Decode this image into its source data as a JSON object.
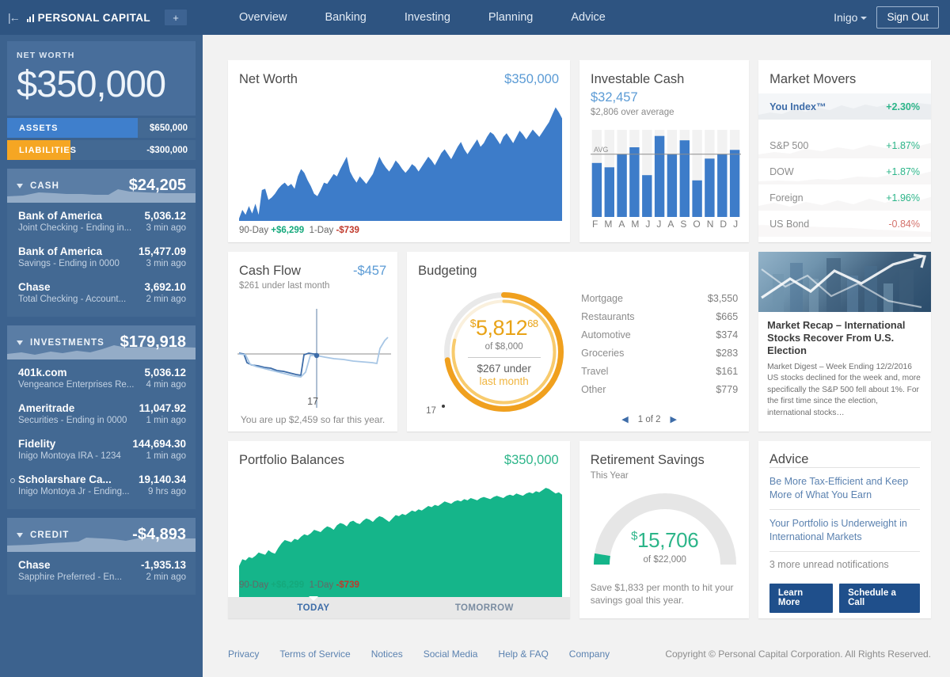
{
  "topnav": {
    "collapse_icon": "collapse-sidebar-icon",
    "brand": "PERSONAL CAPITAL",
    "add_label": "+",
    "menu": [
      {
        "label": "Overview"
      },
      {
        "label": "Banking"
      },
      {
        "label": "Investing"
      },
      {
        "label": "Planning"
      },
      {
        "label": "Advice"
      }
    ],
    "user": "Inigo",
    "sign_out": "Sign Out"
  },
  "sidebar": {
    "net_worth_label": "NET WORTH",
    "net_worth_value": "$350,000",
    "assets_label": "ASSETS",
    "assets_value": "$650,000",
    "liabilities_label": "LIABILITIES",
    "liabilities_value": "-$300,000",
    "groups": [
      {
        "name": "CASH",
        "total": "$24,205",
        "accounts": [
          {
            "name": "Bank of America",
            "balance": "5,036.12",
            "desc": "Joint Checking - Ending in...",
            "time": "3 min ago",
            "dot": false
          },
          {
            "name": "Bank of America",
            "balance": "15,477.09",
            "desc": "Savings - Ending in 0000",
            "time": "3 min ago",
            "dot": false
          },
          {
            "name": "Chase",
            "balance": "3,692.10",
            "desc": "Total Checking - Account...",
            "time": "2 min ago",
            "dot": false
          }
        ]
      },
      {
        "name": "INVESTMENTS",
        "total": "$179,918",
        "accounts": [
          {
            "name": "401k.com",
            "balance": "5,036.12",
            "desc": "Vengeance Enterprises Re...",
            "time": "4 min ago",
            "dot": false
          },
          {
            "name": "Ameritrade",
            "balance": "11,047.92",
            "desc": "Securities - Ending in 0000",
            "time": "1 min ago",
            "dot": false
          },
          {
            "name": "Fidelity",
            "balance": "144,694.30",
            "desc": "Inigo Montoya IRA - 1234",
            "time": "1 min ago",
            "dot": false
          },
          {
            "name": "Scholarshare Ca...",
            "balance": "19,140.34",
            "desc": "Inigo Montoya Jr - Ending...",
            "time": "9 hrs ago",
            "dot": true
          }
        ]
      },
      {
        "name": "CREDIT",
        "total": "-$4,893",
        "accounts": [
          {
            "name": "Chase",
            "balance": "-1,935.13",
            "desc": "Sapphire Preferred - En...",
            "time": "2 min ago",
            "dot": false
          }
        ]
      }
    ]
  },
  "cards": {
    "net_worth": {
      "title": "Net Worth",
      "amount": "$350,000",
      "foot_90_label": "90-Day",
      "foot_90_value": "+$6,299",
      "foot_1_label": "1-Day",
      "foot_1_value": "-$739"
    },
    "investable_cash": {
      "title": "Investable Cash",
      "amount": "$32,457",
      "subtitle": "$2,806 over average",
      "avg_label": "AVG"
    },
    "market_movers": {
      "title": "Market Movers",
      "rows": [
        {
          "name": "You Index™",
          "pct": "+2.30%",
          "dir": "up",
          "highlight": true
        },
        {
          "name": "S&P 500",
          "pct": "+1.87%",
          "dir": "up",
          "highlight": false
        },
        {
          "name": "DOW",
          "pct": "+1.87%",
          "dir": "up",
          "highlight": false
        },
        {
          "name": "Foreign",
          "pct": "+1.96%",
          "dir": "up",
          "highlight": false
        },
        {
          "name": "US Bond",
          "pct": "-0.84%",
          "dir": "down",
          "highlight": false
        }
      ]
    },
    "cash_flow": {
      "title": "Cash Flow",
      "amount": "-$457",
      "subtitle": "$261 under last month",
      "day_label": "17",
      "foot": "You are up $2,459 so far this year."
    },
    "budgeting": {
      "title": "Budgeting",
      "currency": "$",
      "spent": "5,812",
      "cents": "68",
      "of_budget": "of $8,000",
      "delta": "$267 under",
      "delta_period": "last month",
      "day_label": "17",
      "categories": [
        {
          "name": "Mortgage",
          "amount": "$3,550"
        },
        {
          "name": "Restaurants",
          "amount": "$665"
        },
        {
          "name": "Automotive",
          "amount": "$374"
        },
        {
          "name": "Groceries",
          "amount": "$283"
        },
        {
          "name": "Travel",
          "amount": "$161"
        },
        {
          "name": "Other",
          "amount": "$779"
        }
      ],
      "pager": "1 of 2",
      "prev_icon": "chevron-left-icon",
      "next_icon": "chevron-right-icon"
    },
    "market_recap": {
      "title": "Market Recap – International Stocks Recover From U.S. Election",
      "text": "Market Digest – Week Ending 12/2/2016 US stocks declined for the week and, more specifically the S&P 500 fell about 1%. For the first time since the election, international stocks…"
    },
    "portfolio": {
      "title": "Portfolio Balances",
      "amount": "$350,000",
      "foot_90_label": "90-Day",
      "foot_90_value": "+$6,299",
      "foot_1_label": "1-Day",
      "foot_1_value": "-$739",
      "tab_today": "TODAY",
      "tab_tomorrow": "TOMORROW"
    },
    "retirement": {
      "title": "Retirement Savings",
      "subtitle": "This Year",
      "currency": "$",
      "saved": "15,706",
      "of_goal": "of $22,000",
      "foot": "Save $1,833 per month to hit your savings goal this year."
    },
    "advice": {
      "title": "Advice",
      "items": [
        "Be More Tax-Efficient and Keep More of What You Earn",
        "Your Portfolio is Underweight in International Markets"
      ],
      "more": "3 more unread notifications",
      "btn_learn": "Learn More",
      "btn_schedule": "Schedule a Call"
    }
  },
  "footer": {
    "links": [
      "Privacy",
      "Terms of Service",
      "Notices",
      "Social Media",
      "Help & FAQ",
      "Company"
    ],
    "copyright": "Copyright © Personal Capital Corporation. All Rights Reserved."
  },
  "colors": {
    "nav_bg": "#2e5481",
    "sidebar_bg": "#3c628e",
    "assets": "#3f7fcc",
    "liabilities": "#f5a623",
    "positive": "#15a97c",
    "negative": "#c0392b",
    "blue_series": "#3d7cc9",
    "green_series": "#15b58a",
    "budget_orange": "#f0a01e",
    "link": "#5b82b0"
  },
  "chart_data": [
    {
      "type": "area",
      "name": "net_worth_90day",
      "title": "Net Worth",
      "ylabel": "",
      "xlabel": "",
      "grid": false,
      "color": "#3d7cc9",
      "values": [
        2,
        9,
        5,
        12,
        6,
        14,
        5,
        25,
        26,
        17,
        19,
        22,
        26,
        29,
        31,
        28,
        30,
        26,
        36,
        42,
        39,
        33,
        28,
        22,
        20,
        25,
        31,
        30,
        34,
        38,
        36,
        42,
        47,
        52,
        40,
        35,
        31,
        36,
        33,
        30,
        34,
        38,
        45,
        52,
        47,
        43,
        40,
        44,
        49,
        46,
        42,
        39,
        42,
        46,
        44,
        40,
        44,
        48,
        52,
        49,
        45,
        50,
        55,
        58,
        54,
        50,
        55,
        60,
        64,
        58,
        54,
        58,
        62,
        66,
        60,
        63,
        68,
        72,
        70,
        66,
        62,
        68,
        71,
        67,
        63,
        68,
        73,
        70,
        66,
        70,
        74,
        71,
        68,
        72,
        76,
        80,
        86,
        92,
        88,
        83
      ]
    },
    {
      "type": "bar",
      "name": "investable_cash_monthly",
      "title": "Investable Cash",
      "categories": [
        "F",
        "M",
        "A",
        "M",
        "J",
        "J",
        "A",
        "S",
        "O",
        "N",
        "D",
        "J"
      ],
      "values": [
        62,
        57,
        72,
        80,
        48,
        93,
        72,
        88,
        42,
        67,
        72,
        77
      ],
      "avg": 72,
      "avg_label": "AVG",
      "color": "#3d7cc9",
      "ylim": [
        0,
        100
      ]
    },
    {
      "type": "line",
      "name": "cash_flow_month",
      "title": "Cash Flow",
      "series": [
        {
          "name": "this_month",
          "values": [
            0,
            -2,
            -22,
            -26,
            -28,
            -29,
            -33,
            -34,
            -36,
            -40,
            -42,
            -44,
            -45,
            -47,
            -48,
            -2,
            -1,
            -3
          ]
        },
        {
          "name": "last_month",
          "values": [
            0,
            -3,
            -20,
            -24,
            -27,
            -30,
            -34,
            -37,
            -40,
            -42,
            -44,
            -46,
            -48,
            -49,
            -44,
            -5,
            -4,
            -3,
            -5,
            -7,
            -8,
            -9,
            -10,
            -11,
            -12,
            -13,
            -14,
            -15,
            -16,
            -17,
            -18,
            -18,
            -17,
            30
          ]
        }
      ],
      "marker_day": 17,
      "color_this": "#3d7cc9",
      "color_last": "#a7c6e5"
    },
    {
      "type": "pie",
      "name": "budget_donut",
      "title": "Budgeting",
      "spent": 5812.68,
      "budget": 8000,
      "percent": 72.7,
      "categories": [
        "Mortgage",
        "Restaurants",
        "Automotive",
        "Groceries",
        "Travel",
        "Other"
      ],
      "values": [
        3550,
        665,
        374,
        283,
        161,
        779
      ],
      "color": "#f0a01e",
      "last_month_color": "#f8cb6d"
    },
    {
      "type": "area",
      "name": "portfolio_balances_90day",
      "title": "Portfolio Balances",
      "color": "#15b58a",
      "values": [
        28,
        34,
        33,
        36,
        35,
        37,
        40,
        39,
        38,
        42,
        40,
        39,
        44,
        48,
        51,
        50,
        49,
        52,
        51,
        54,
        56,
        55,
        57,
        60,
        59,
        58,
        61,
        63,
        62,
        60,
        64,
        66,
        65,
        63,
        67,
        68,
        66,
        65,
        68,
        70,
        69,
        67,
        70,
        72,
        71,
        69,
        67,
        70,
        73,
        72,
        74,
        73,
        75,
        77,
        76,
        78,
        77,
        79,
        81,
        80,
        82,
        81,
        83,
        85,
        84,
        83,
        85,
        86,
        85,
        87,
        86,
        88,
        87,
        86,
        88,
        89,
        88,
        87,
        89,
        90,
        89,
        88,
        90,
        91,
        90,
        92,
        91,
        90,
        92,
        93,
        92,
        94,
        93,
        95,
        97,
        96,
        94,
        92,
        93,
        91
      ]
    },
    {
      "type": "pie",
      "name": "retirement_gauge",
      "title": "Retirement Savings",
      "saved": 15706,
      "goal": 22000,
      "percent": 5,
      "color": "#15b58a",
      "track_color": "#e6e6e6"
    }
  ]
}
